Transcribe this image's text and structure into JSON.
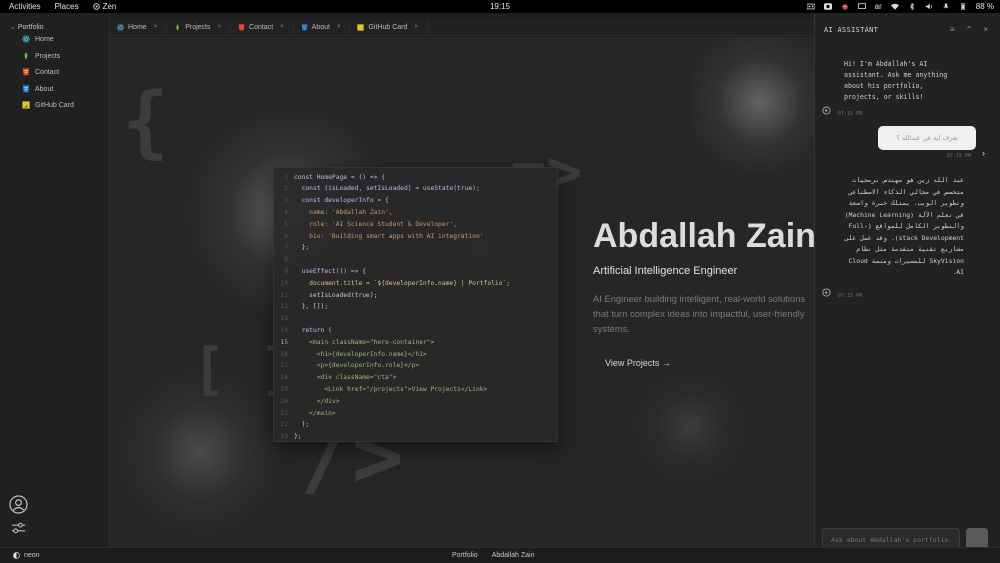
{
  "topbar": {
    "activities": "Activities",
    "places": "Places",
    "app_name": "Zen",
    "clock": "19:15",
    "keyboard_layout": "ar",
    "battery": "88 %"
  },
  "explorer": {
    "root": "Portfolio",
    "items": [
      {
        "label": "Home",
        "icon": "react-icon",
        "color": "#4fb6d6"
      },
      {
        "label": "Projects",
        "icon": "leaf-icon",
        "color": "#6cc24a"
      },
      {
        "label": "Contact",
        "icon": "html-icon",
        "color": "#e44d26"
      },
      {
        "label": "About",
        "icon": "css-icon",
        "color": "#2f7fd1"
      },
      {
        "label": "GitHub Card",
        "icon": "js-icon",
        "color": "#e8c22a"
      }
    ]
  },
  "tabs": [
    {
      "label": "Home",
      "icon": "react-icon",
      "close": "×"
    },
    {
      "label": "Projects",
      "icon": "leaf-icon",
      "close": "×"
    },
    {
      "label": "Contact",
      "icon": "html-icon",
      "close": "×"
    },
    {
      "label": "About",
      "icon": "css-icon",
      "close": "×"
    },
    {
      "label": "GitHub Card",
      "icon": "js-icon",
      "close": "×"
    }
  ],
  "code": {
    "active_line": 15,
    "lines": [
      {
        "n": "1",
        "text": "const HomePage = () => {"
      },
      {
        "n": "2",
        "text": "  const [isLoaded, setIsLoaded] = useState(true);"
      },
      {
        "n": "3",
        "text": "  const developerInfo = {"
      },
      {
        "n": "4",
        "text": "    name: 'Abdallah Zain',"
      },
      {
        "n": "5",
        "text": "    role: 'AI Science Student & Developer',"
      },
      {
        "n": "6",
        "text": "    bio: 'Building smart apps with AI integration'"
      },
      {
        "n": "7",
        "text": "  };"
      },
      {
        "n": "8",
        "text": ""
      },
      {
        "n": "9",
        "text": "  useEffect(() => {"
      },
      {
        "n": "10",
        "text": "    document.title = `${developerInfo.name} | Portfolio`;"
      },
      {
        "n": "11",
        "text": "    setIsLoaded(true);"
      },
      {
        "n": "12",
        "text": "  }, []);"
      },
      {
        "n": "13",
        "text": ""
      },
      {
        "n": "14",
        "text": "  return ("
      },
      {
        "n": "15",
        "text": "    <main className=\"hero-container\">"
      },
      {
        "n": "16",
        "text": "      <h1>{developerInfo.name}</h1>"
      },
      {
        "n": "17",
        "text": "      <p>{developerInfo.role}</p>"
      },
      {
        "n": "18",
        "text": "      <div className=\"cta\">"
      },
      {
        "n": "19",
        "text": "        <Link href=\"/projects\">View Projects</Link>"
      },
      {
        "n": "20",
        "text": "      </div>"
      },
      {
        "n": "21",
        "text": "    </main>"
      },
      {
        "n": "22",
        "text": "  );"
      },
      {
        "n": "23",
        "text": "};"
      }
    ]
  },
  "hero": {
    "name": "Abdallah Zain",
    "role": "Artificial Intelligence Engineer",
    "description": "AI Engineer building intelligent, real-world solutions that turn complex ideas into impactful, user-friendly systems.",
    "cta": "View Projects →"
  },
  "statusbar": {
    "theme": "neon",
    "items": [
      "Portfolio",
      "Abdallah Zain"
    ]
  },
  "assistant": {
    "title": "AI ASSISTANT",
    "messages": [
      {
        "from": "bot",
        "text": "Hi! I'm Abdallah's AI assistant. Ask me anything about his portfolio, projects, or skills!",
        "time": "07:15 PM"
      },
      {
        "from": "user",
        "text": "تعرف ايه عن عبدالله ؟",
        "time": "07:15 PM"
      },
      {
        "from": "bot",
        "text": "عبد الله زين هو مهندس برمجيات متخصص في مجالي الذكاء الاصطناعي وتطوير الويب، يمتلك خبرة واسعة في تعلم الآلة (Machine Learning) والتطوير الكامل للمواقع (Full-stack Development). وقد عمل على مشاريع تقنية متقدمة مثل نظام SkyVision للمسيرات ومنصة Cloud AI.",
        "time": "07:15 PM"
      }
    ],
    "input_placeholder": "Ask about Abdallah's portfolio..."
  },
  "colors": {
    "accent_text": "#dcdcdc",
    "keyword": "#d98c7c",
    "string": "#c99a6a",
    "tag": "#9bb57a",
    "ident": "#c7b6e6"
  }
}
